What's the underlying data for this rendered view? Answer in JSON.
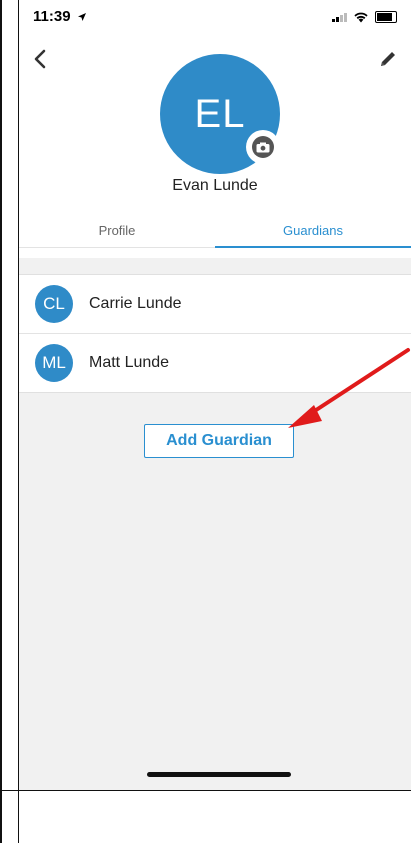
{
  "status_bar": {
    "time": "11:39"
  },
  "profile": {
    "initials": "EL",
    "name": "Evan Lunde"
  },
  "tabs": [
    {
      "label": "Profile",
      "active": false
    },
    {
      "label": "Guardians",
      "active": true
    }
  ],
  "guardians": [
    {
      "initials": "CL",
      "name": "Carrie Lunde"
    },
    {
      "initials": "ML",
      "name": "Matt Lunde"
    }
  ],
  "actions": {
    "add_guardian_label": "Add Guardian"
  },
  "icons": {
    "back": "chevron-left-icon",
    "edit": "pencil-icon",
    "camera": "camera-icon",
    "location": "location-arrow-icon"
  },
  "colors": {
    "accent": "#2a8fd0",
    "avatar": "#2f8bc8",
    "annotation": "#e01b1b",
    "background": "#f1f1f1"
  }
}
